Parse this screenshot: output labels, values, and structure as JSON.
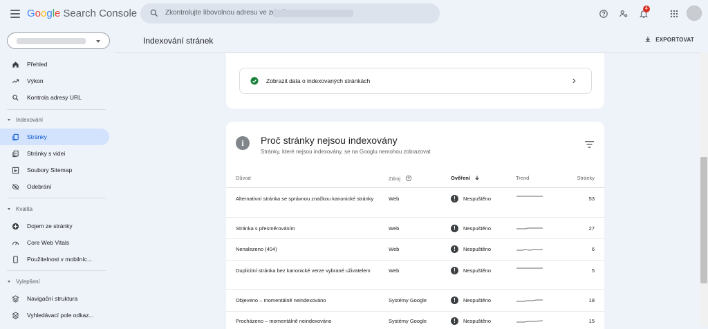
{
  "app": {
    "logo_parts": [
      "G",
      "o",
      "o",
      "g",
      "l",
      "e"
    ],
    "product": "Search Console"
  },
  "search": {
    "placeholder": "Zkontrolujte libovolnou adresu ve zdroji"
  },
  "topbar": {
    "notification_count": "4"
  },
  "sidebar": {
    "items_top": [
      {
        "label": "Přehled",
        "icon": "home-icon"
      },
      {
        "label": "Výkon",
        "icon": "trending-up-icon"
      },
      {
        "label": "Kontrola adresy URL",
        "icon": "search-icon"
      }
    ],
    "section_indexing": "Indexování",
    "items_indexing": [
      {
        "label": "Stránky",
        "icon": "pages-icon",
        "active": true
      },
      {
        "label": "Stránky s videi",
        "icon": "video-pages-icon"
      },
      {
        "label": "Soubory Sitemap",
        "icon": "sitemap-icon"
      },
      {
        "label": "Odebrání",
        "icon": "removals-icon"
      }
    ],
    "section_quality": "Kvalita",
    "items_quality": [
      {
        "label": "Dojem ze stránky",
        "icon": "page-experience-icon"
      },
      {
        "label": "Core Web Vitals",
        "icon": "speed-icon"
      },
      {
        "label": "Použitelnost v mobilníc...",
        "icon": "mobile-icon"
      }
    ],
    "section_enhancements": "Vylepšení",
    "items_enhancements": [
      {
        "label": "Navigační struktura",
        "icon": "breadcrumbs-icon"
      },
      {
        "label": "Vyhledávací pole odkaz...",
        "icon": "sitelinks-searchbox-icon"
      }
    ]
  },
  "header": {
    "title": "Indexování stránek",
    "export_label": "EXPORTOVAT"
  },
  "indexed_link": {
    "label": "Zobrazit data o indexovaných stránkách"
  },
  "not_indexed": {
    "title": "Proč stránky nejsou indexovány",
    "subtitle": "Stránky, které nejsou indexovány, se na Googlu nemohou zobrazovat",
    "columns": {
      "reason": "Důvod",
      "source": "Zdroj",
      "validation": "Ověření",
      "trend": "Trend",
      "pages": "Stránky"
    },
    "rows": [
      {
        "reason": "Alternativní stránka se správnou značkou kanonické stránky",
        "source": "Web",
        "validation": "Nespuštěno",
        "pages": "53"
      },
      {
        "reason": "Stránka s přesměrováním",
        "source": "Web",
        "validation": "Nespuštěno",
        "pages": "27"
      },
      {
        "reason": "Nenalezeno (404)",
        "source": "Web",
        "validation": "Nespuštěno",
        "pages": "6"
      },
      {
        "reason": "Duplicitní stránka bez kanonické verze vybrané uživatelem",
        "source": "Web",
        "validation": "Nespuštěno",
        "pages": "5"
      },
      {
        "reason": "Objeveno – momentálně neindexováno",
        "source": "Systémy Google",
        "validation": "Nespuštěno",
        "pages": "18"
      },
      {
        "reason": "Procházeno – momentálně neindexováno",
        "source": "Systémy Google",
        "validation": "Nespuštěno",
        "pages": "15"
      }
    ]
  },
  "colors": {
    "active_nav": "#d3e3fd",
    "check_green": "#188038",
    "badge_red": "#d93025"
  }
}
